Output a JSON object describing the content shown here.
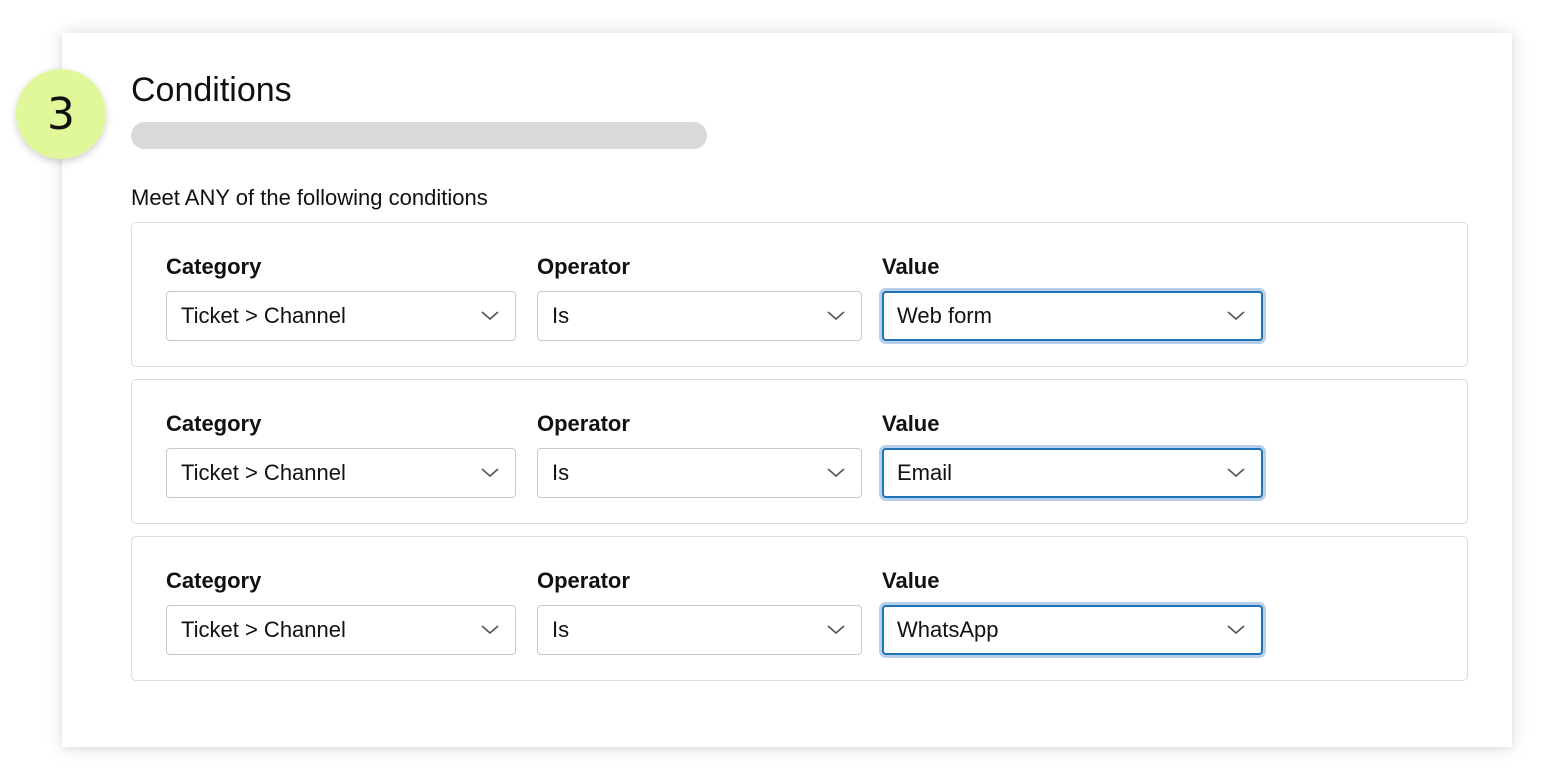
{
  "step": {
    "number": "3"
  },
  "section": {
    "title": "Conditions",
    "rule_text": "Meet ANY of the following conditions"
  },
  "colors": {
    "badge_bg": "#e1f89a",
    "focus_border": "#1f73b7",
    "focus_ring": "#b7cfea",
    "placeholder_bar": "#d9d9d9"
  },
  "conditions": [
    {
      "category_label": "Category",
      "category_value": "Ticket > Channel",
      "operator_label": "Operator",
      "operator_value": "Is",
      "value_label": "Value",
      "value_value": "Web form"
    },
    {
      "category_label": "Category",
      "category_value": "Ticket > Channel",
      "operator_label": "Operator",
      "operator_value": "Is",
      "value_label": "Value",
      "value_value": "Email"
    },
    {
      "category_label": "Category",
      "category_value": "Ticket > Channel",
      "operator_label": "Operator",
      "operator_value": "Is",
      "value_label": "Value",
      "value_value": "WhatsApp"
    }
  ],
  "icons": {
    "dropdown": "chevron-down-icon"
  }
}
